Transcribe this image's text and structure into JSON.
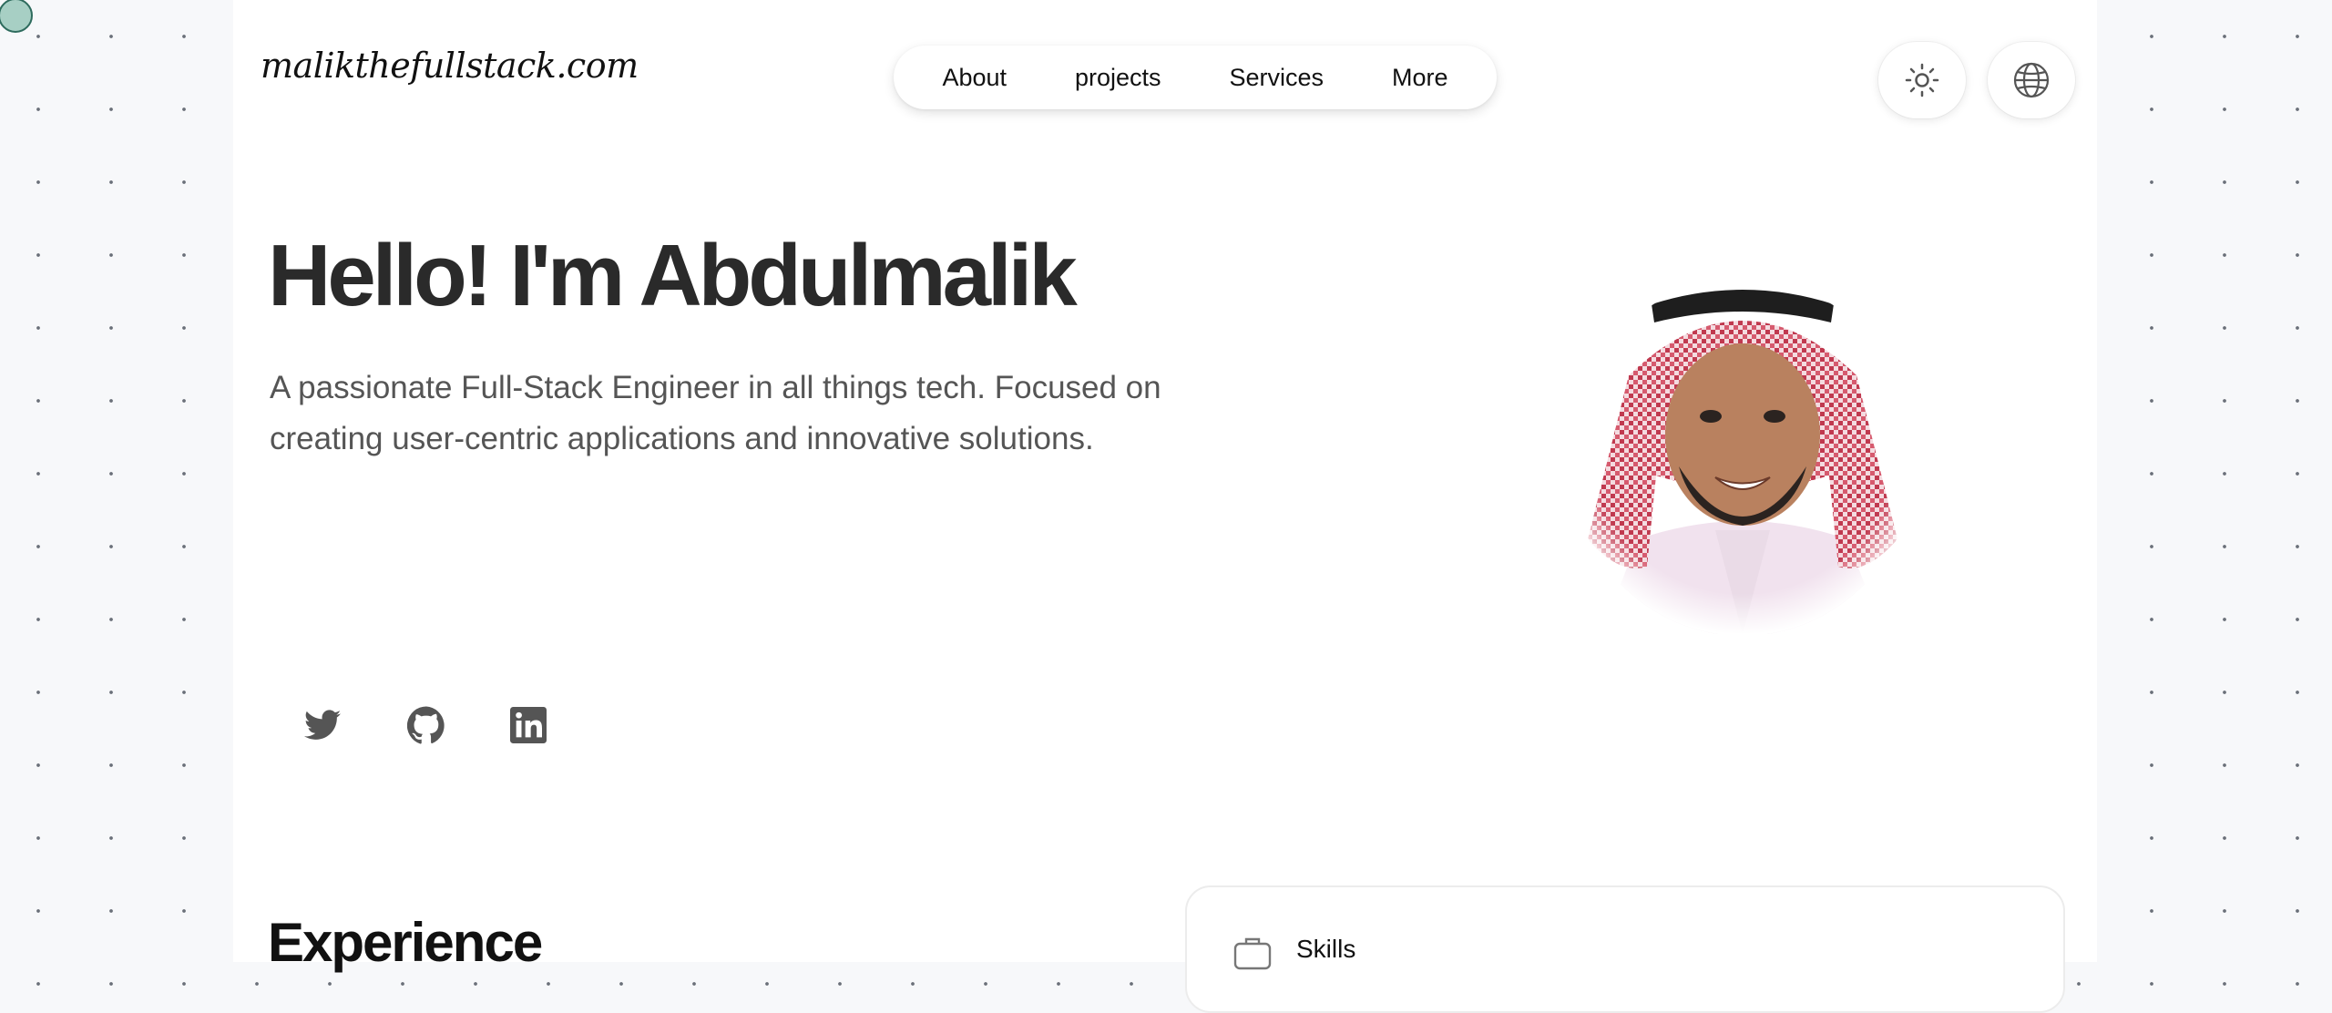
{
  "header": {
    "logo": "malikthefullstack.com",
    "nav": [
      "About",
      "projects",
      "Services",
      "More"
    ]
  },
  "hero": {
    "title": "Hello! I'm Abdulmalik",
    "description": "A passionate Full-Stack Engineer in all things tech. Focused on creating user-centric applications and innovative solutions."
  },
  "social": [
    "twitter-icon",
    "github-icon",
    "linkedin-icon"
  ],
  "experience": {
    "title": "Experience"
  },
  "skills": {
    "label": "Skills"
  },
  "colors": {
    "background": "#f7f8fa",
    "page": "#ffffff",
    "text": "#2a2a2a",
    "muted": "#555555"
  }
}
